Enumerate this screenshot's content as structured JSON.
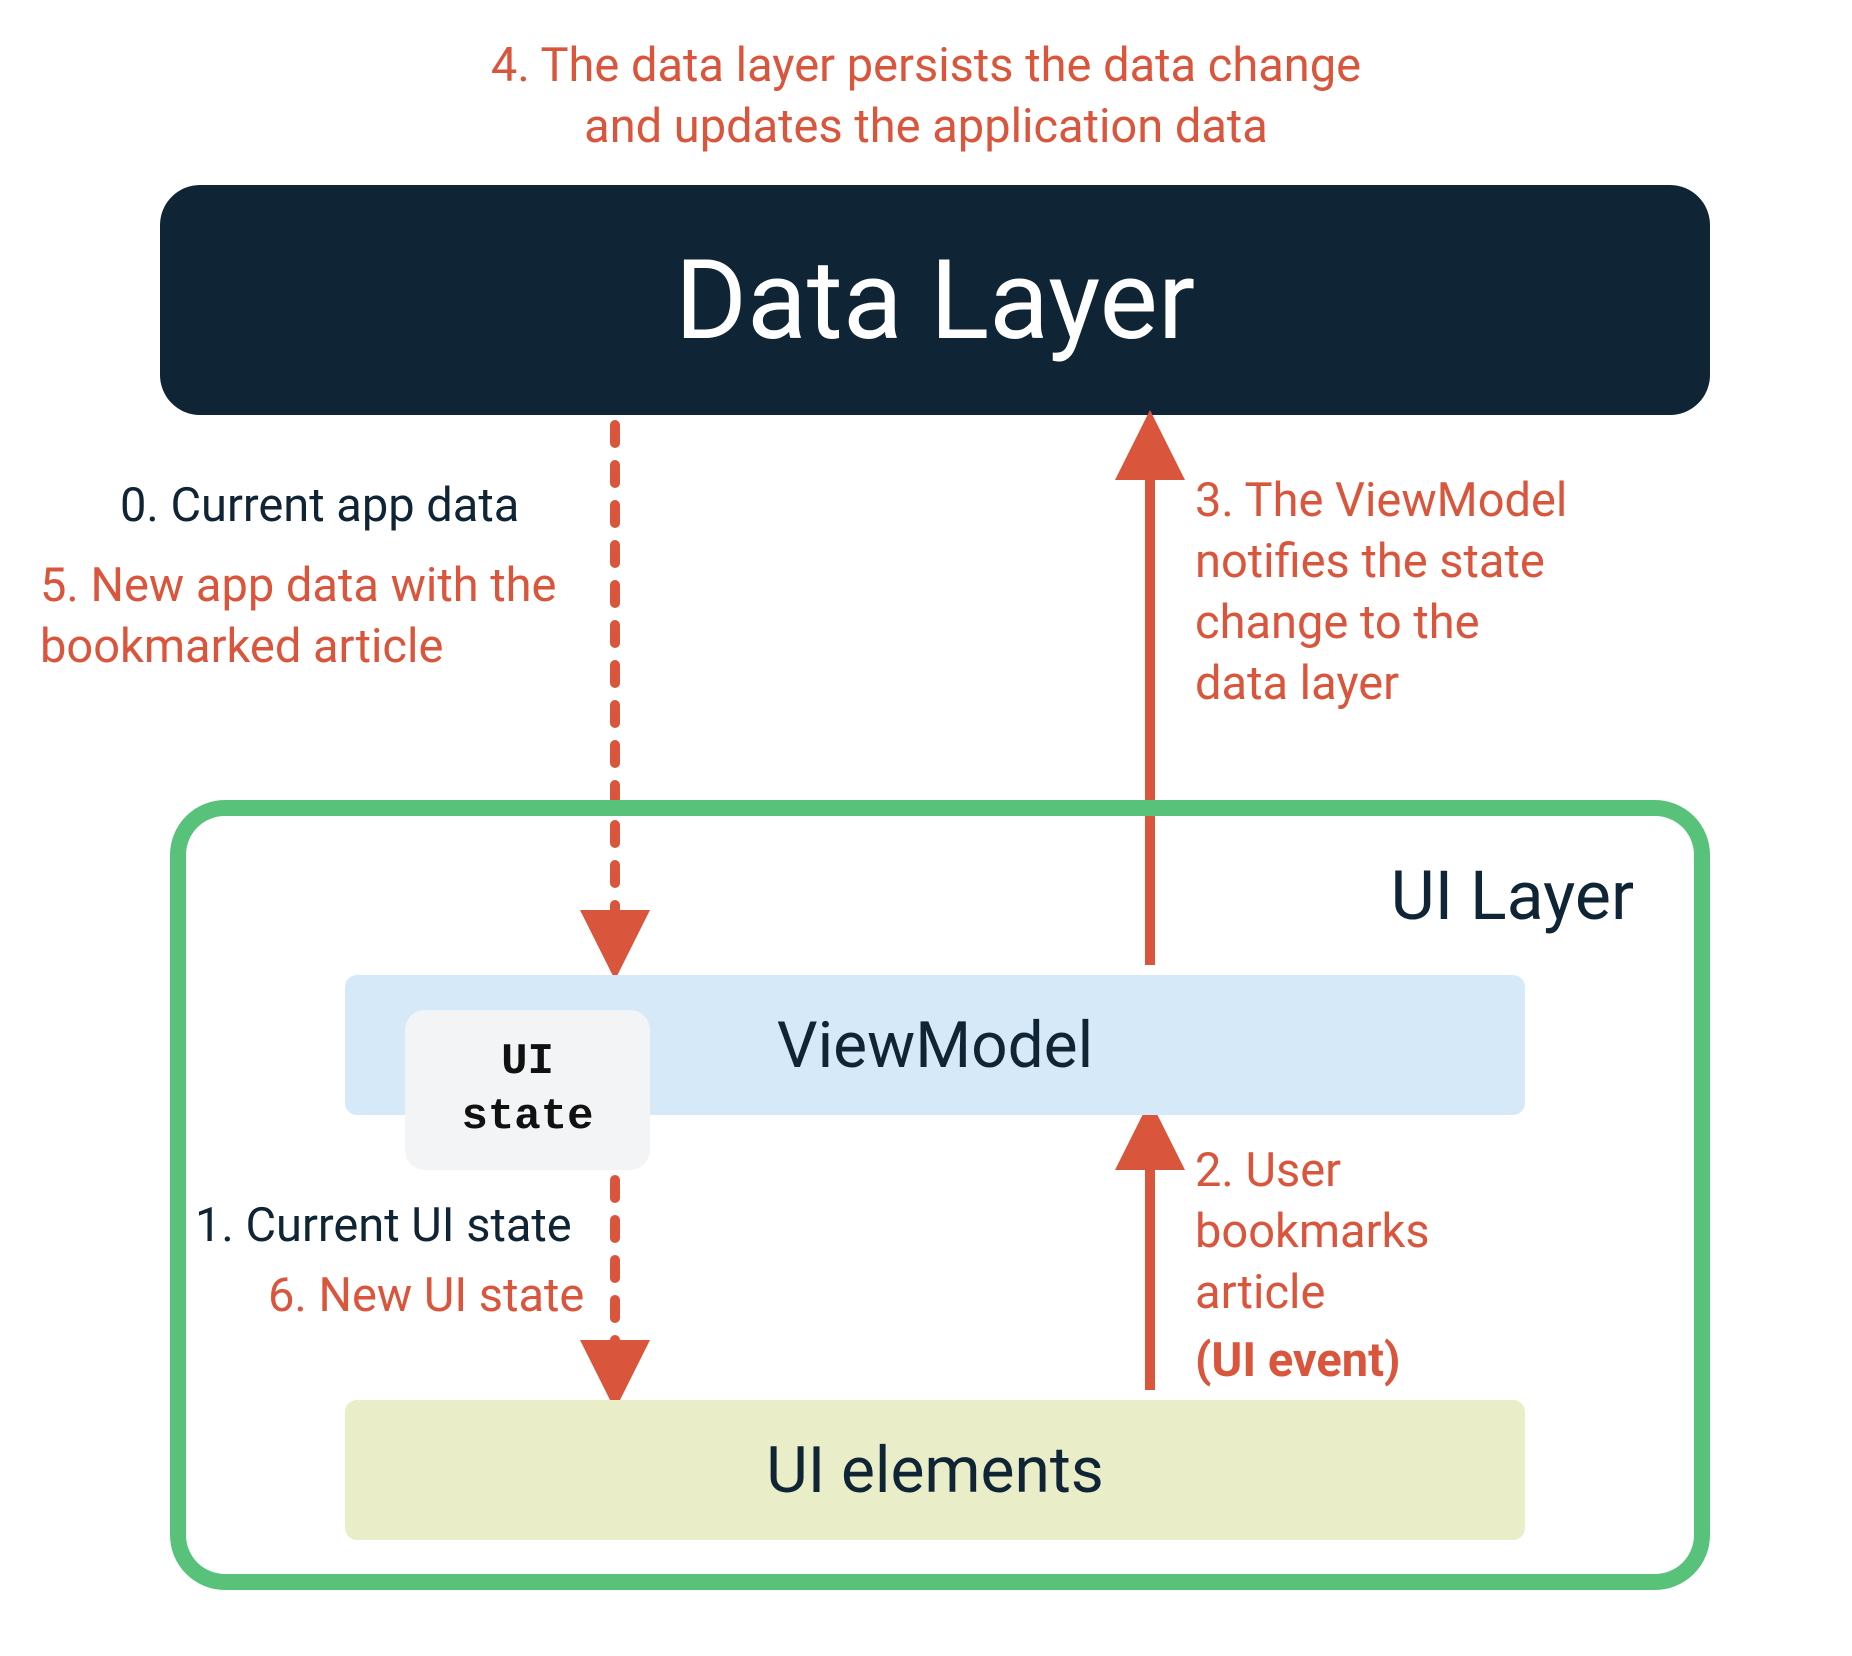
{
  "caption_top": "4. The data layer persists the data change\nand updates the application data",
  "boxes": {
    "data_layer": "Data Layer",
    "ui_layer": "UI Layer",
    "viewmodel": "ViewModel",
    "ui_state": "UI\nstate",
    "ui_elements": "UI elements"
  },
  "labels": {
    "step0": "0. Current app data",
    "step5": "5. New app data with the\nbookmarked article",
    "step1": "1. Current UI state",
    "step6": "6. New UI state",
    "step3": "3. The ViewModel\nnotifies the state\nchange to the\ndata layer",
    "step2a": "2. User\nbookmarks\narticle",
    "step2b": "(UI event)"
  },
  "colors": {
    "navy": "#0f2535",
    "red": "#d9553b",
    "green": "#58c17a",
    "blue_light": "#d6e9f9",
    "olive_light": "#e9edc8"
  }
}
